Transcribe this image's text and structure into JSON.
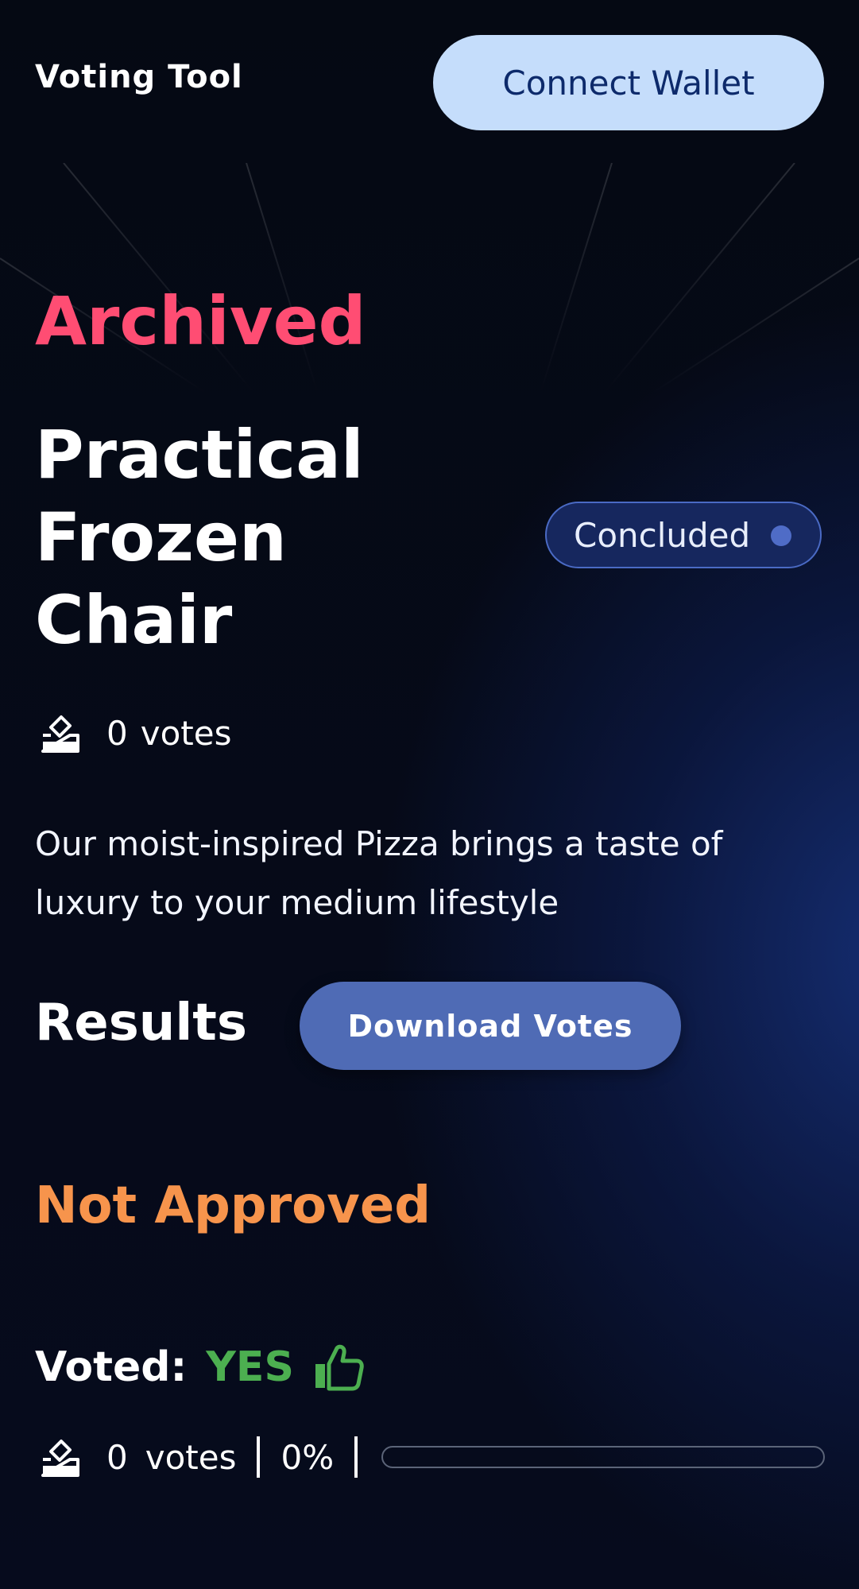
{
  "header": {
    "app_title": "Voting Tool",
    "connect_label": "Connect Wallet"
  },
  "proposal": {
    "archive_label": "Archived",
    "title_lines": [
      "Practical",
      "Frozen",
      "Chair"
    ],
    "status": "Concluded",
    "votes_count": "0",
    "votes_label": "votes",
    "description": "Our moist-inspired Pizza brings a taste of luxury to your medium lifestyle"
  },
  "results": {
    "title": "Results",
    "download_label": "Download Votes",
    "outcome": "Not Approved",
    "voted_label": "Voted:",
    "voted_value": "YES",
    "tally_count": "0",
    "tally_label": "votes",
    "tally_percent": "0%",
    "tally_fraction": 0
  },
  "icons": {
    "ballot": "ballot-icon",
    "thumbs_up": "thumbs-up-icon"
  },
  "colors": {
    "archived": "#ff4d73",
    "outcome": "#f7944c",
    "yes": "#4caf50",
    "connect_bg": "#c5ddfb",
    "download_bg": "#4f6bb5",
    "badge_border": "#4a6ac4"
  }
}
